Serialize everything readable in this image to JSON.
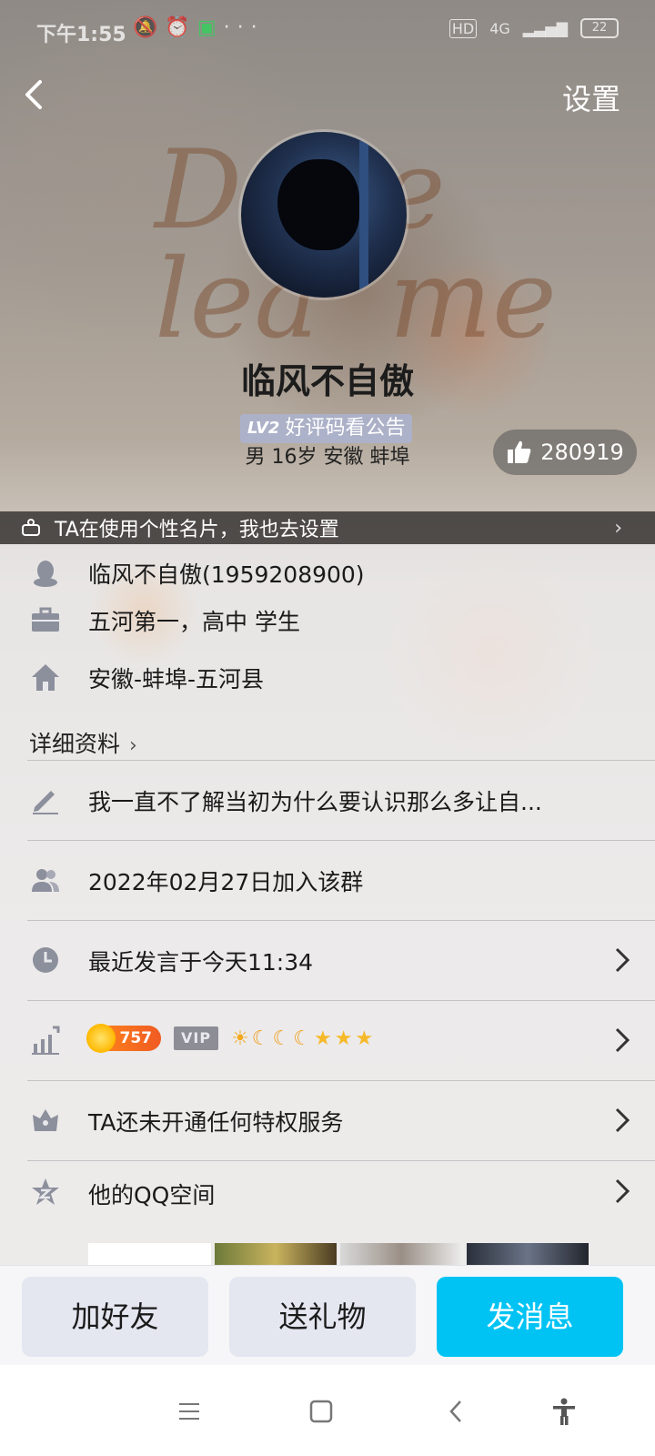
{
  "status_bar": {
    "time": "下午1:55",
    "network": "4G",
    "hd_label": "HD",
    "battery": "22"
  },
  "header": {
    "settings_label": "设置"
  },
  "profile": {
    "nickname": "临风不自傲",
    "level_tag": "LV2",
    "level_text": "好评码看公告",
    "basic_info": "男 16岁 安徽 蚌埠",
    "likes": "280919"
  },
  "card_banner": {
    "text": "TA在使用个性名片，我也去设置"
  },
  "info": {
    "name_qq": "临风不自傲(1959208900)",
    "school": "五河第一，高中 学生",
    "location": "安徽-蚌埠-五河县",
    "detail_link": "详细资料"
  },
  "rows": {
    "signature": "我一直不了解当初为什么要认识那么多让自...",
    "joined": "2022年02月27日加入该群",
    "last_speak": "最近发言于今天11:34",
    "coin_value": "757",
    "vip_label": "VIP",
    "privilege": "TA还未开通任何特权服务",
    "qzone": "他的QQ空间"
  },
  "actions": {
    "add_friend": "加好友",
    "send_gift": "送礼物",
    "send_message": "发消息"
  },
  "colors": {
    "primary": "#00c3f4",
    "secondary": "#e4e6f0",
    "coin": "#f05a22"
  }
}
